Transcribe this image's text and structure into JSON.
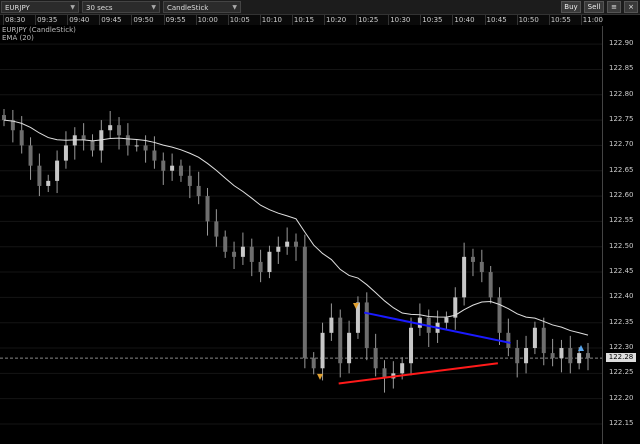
{
  "toolbar": {
    "symbol": "EURJPY",
    "interval": "30 secs",
    "chart_style": "CandleStick",
    "buy_label": "Buy",
    "sell_label": "Sell"
  },
  "time_axis": [
    "08:30",
    "09:35",
    "09:40",
    "09:45",
    "09:50",
    "09:55",
    "10:00",
    "10:05",
    "10:10",
    "10:15",
    "10:20",
    "10:25",
    "10:30",
    "10:35",
    "10:40",
    "10:45",
    "10:50",
    "10:55",
    "11:00"
  ],
  "chart_info": {
    "series_label": "EURJPY (CandleStick)",
    "indicator_label": "EMA (20)"
  },
  "y_axis": [
    "122.90",
    "122.85",
    "122.80",
    "122.75",
    "122.70",
    "122.65",
    "122.60",
    "122.55",
    "122.50",
    "122.45",
    "122.40",
    "122.35",
    "122.30",
    "122.25",
    "122.20",
    "122.15"
  ],
  "current_price": "122.28",
  "colors": {
    "candle": "#9a9a9a",
    "ema": "#e0e0e0",
    "trendline_upper": "#1a1aff",
    "trendline_lower": "#ff1a1a",
    "marker_down": "#e0a030",
    "marker_up": "#59a8f0"
  },
  "chart_data": {
    "type": "candlestick",
    "instrument": "EURJPY",
    "timeframe": "30 secs",
    "ylim": [
      122.15,
      122.92
    ],
    "current_price": 122.28,
    "close_series": [
      122.75,
      122.73,
      122.7,
      122.66,
      122.62,
      122.63,
      122.67,
      122.7,
      122.72,
      122.71,
      122.69,
      122.73,
      122.74,
      122.72,
      122.7,
      122.7,
      122.69,
      122.67,
      122.65,
      122.66,
      122.64,
      122.62,
      122.6,
      122.55,
      122.52,
      122.49,
      122.48,
      122.5,
      122.47,
      122.45,
      122.49,
      122.5,
      122.51,
      122.5,
      122.28,
      122.26,
      122.33,
      122.36,
      122.27,
      122.33,
      122.39,
      122.3,
      122.26,
      122.24,
      122.25,
      122.27,
      122.34,
      122.36,
      122.33,
      122.35,
      122.36,
      122.4,
      122.48,
      122.47,
      122.45,
      122.4,
      122.33,
      122.3,
      122.27,
      122.3,
      122.34,
      122.29,
      122.28,
      122.3,
      122.27,
      122.29,
      122.28
    ],
    "ema_label": "EMA (20)",
    "trendlines": [
      {
        "color": "blue",
        "from": [
          "10:25",
          122.37
        ],
        "to": [
          "10:48",
          122.31
        ]
      },
      {
        "color": "red",
        "from": [
          "10:21",
          122.23
        ],
        "to": [
          "10:46",
          122.27
        ]
      }
    ]
  }
}
